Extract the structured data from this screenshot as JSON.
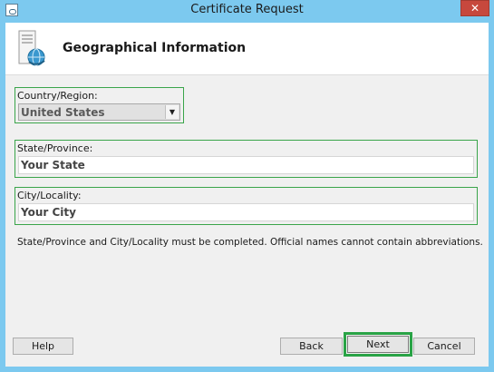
{
  "window": {
    "title": "Certificate Request",
    "close_label": "✕"
  },
  "header": {
    "title": "Geographical Information"
  },
  "form": {
    "country": {
      "label": "Country/Region:",
      "value": "United States"
    },
    "state": {
      "label": "State/Province:",
      "value": "Your State"
    },
    "city": {
      "label": "City/Locality:",
      "value": "Your City"
    },
    "note": "State/Province and City/Locality must be completed. Official names cannot contain abbreviations."
  },
  "buttons": {
    "help": "Help",
    "back": "Back",
    "next": "Next",
    "cancel": "Cancel"
  },
  "colors": {
    "titlebar": "#7cc9ef",
    "highlight": "#29a346",
    "close": "#c7483d"
  }
}
